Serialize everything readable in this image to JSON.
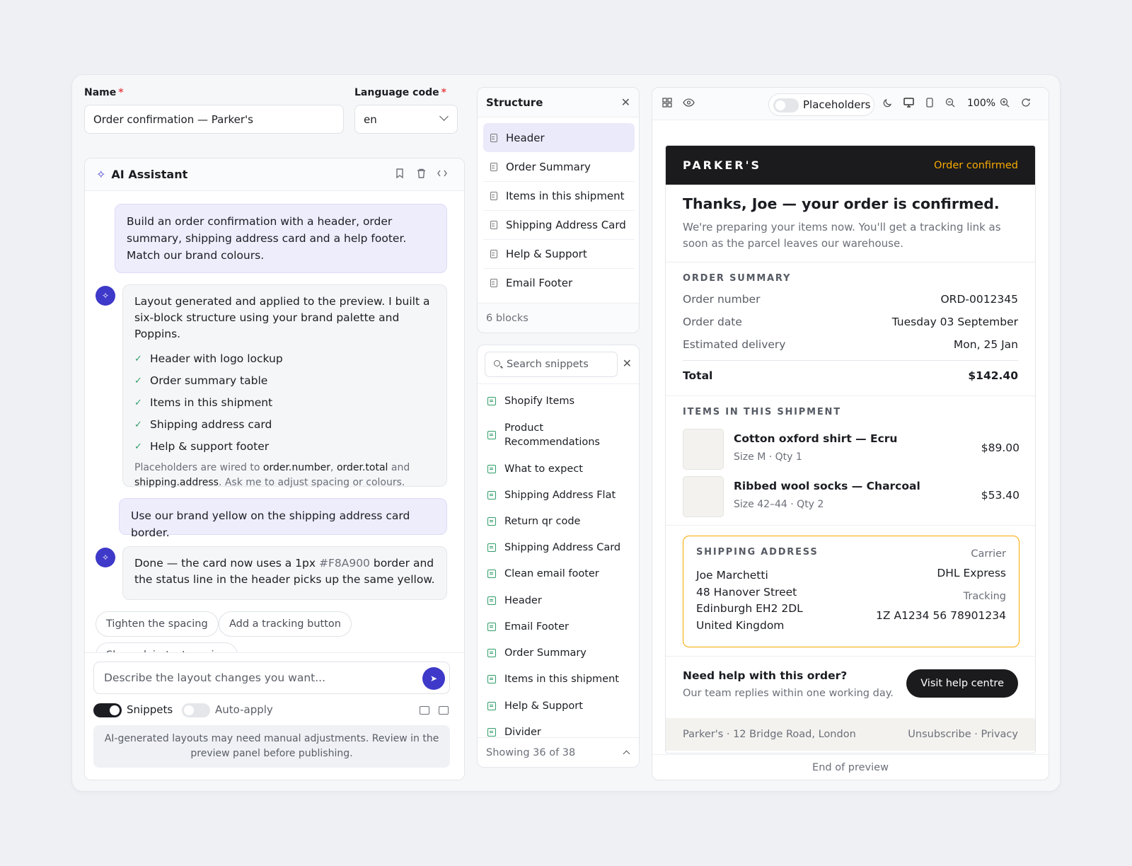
{
  "form": {
    "name_label": "Name",
    "name_value": "Order confirmation — Parker's",
    "lang_label": "Language code",
    "lang_value": "en",
    "required_mark": "*"
  },
  "assistant": {
    "title": "AI Assistant",
    "messages": {
      "user1": "Build an order confirmation with a header, order summary, shipping address card and a help footer. Match our brand colours.",
      "ai1_intro": "Layout generated and applied to the preview. I built a six-block structure using your brand palette and Poppins.",
      "ai1_checks": [
        "Header with logo lockup",
        "Order summary table",
        "Items in this shipment",
        "Shipping address card",
        "Help & support footer"
      ],
      "ai1_note_a": "Placeholders are wired to",
      "ai1_note_p1": "order.number",
      "ai1_note_comma": ",",
      "ai1_note_p2": "order.total",
      "ai1_note_and": "and",
      "ai1_note_p3": "shipping.address",
      "ai1_note_b": ". Ask me to adjust spacing or colours.",
      "user2": "Use our brand yellow on the shipping address card border.",
      "ai2_a": "Done — the card now uses a 1px",
      "ai2_hex": "#F8A900",
      "ai2_b": "border and the status line in the header picks up the same yellow."
    },
    "chips": [
      "Tighten the spacing",
      "Add a tracking button",
      "Show plain-text version"
    ],
    "prompt_placeholder": "Describe the layout changes you want...",
    "toggle_snippets": "Snippets",
    "toggle_autoapply": "Auto-apply",
    "disclaimer": "AI-generated layouts may need manual adjustments. Review in the preview panel before publishing."
  },
  "structure": {
    "title": "Structure",
    "items": [
      "Header",
      "Order Summary",
      "Items in this shipment",
      "Shipping Address Card",
      "Help & Support",
      "Email Footer"
    ],
    "count": "6 blocks"
  },
  "snippets": {
    "search_placeholder": "Search snippets",
    "items": [
      "Shopify Items",
      "Product Recommendations",
      "What to expect",
      "Shipping Address Flat",
      "Return qr code",
      "Shipping Address Card",
      "Clean email footer",
      "Header",
      "Email Footer",
      "Order Summary",
      "Items in this shipment",
      "Help & Support",
      "Divider"
    ],
    "footer": "Showing 36 of 38"
  },
  "preview": {
    "placeholders_label": "Placeholders",
    "zoom": "100%",
    "end": "End of preview",
    "email": {
      "brand": "PARKER'S",
      "status": "Order confirmed",
      "headline": "Thanks, Joe — your order is confirmed.",
      "intro": "We're preparing your items now. You'll get a tracking link as soon as the parcel leaves our warehouse.",
      "summary_title": "ORDER SUMMARY",
      "summary_rows": [
        {
          "k": "Order number",
          "v": "ORD-0012345"
        },
        {
          "k": "Order date",
          "v": "Tuesday 03 September"
        },
        {
          "k": "Estimated delivery",
          "v": "Mon, 25 Jan"
        }
      ],
      "total_k": "Total",
      "total_v": "$142.40",
      "items_title": "ITEMS IN THIS SHIPMENT",
      "items": [
        {
          "name": "Cotton oxford shirt — Ecru",
          "meta": "Size M · Qty 1",
          "price": "$89.00"
        },
        {
          "name": "Ribbed wool socks — Charcoal",
          "meta": "Size 42–44 · Qty 2",
          "price": "$53.40"
        }
      ],
      "ship_title": "SHIPPING ADDRESS",
      "address": [
        "Joe Marchetti",
        "48 Hanover Street",
        "Edinburgh EH2 2DL",
        "United Kingdom"
      ],
      "carrier_k": "Carrier",
      "carrier_v": "DHL Express",
      "tracking_k": "Tracking",
      "tracking_v": "1Z A1234 56 78901234",
      "help_title": "Need help with this order?",
      "help_text": "Our team replies within one working day.",
      "help_button": "Visit help centre",
      "footer_left": "Parker's · 12 Bridge Road, London",
      "footer_right": "Unsubscribe · Privacy"
    }
  },
  "colors": {
    "accent": "#3e39c9",
    "brand_yellow": "#F8A900",
    "dark": "#1b1b1d"
  }
}
